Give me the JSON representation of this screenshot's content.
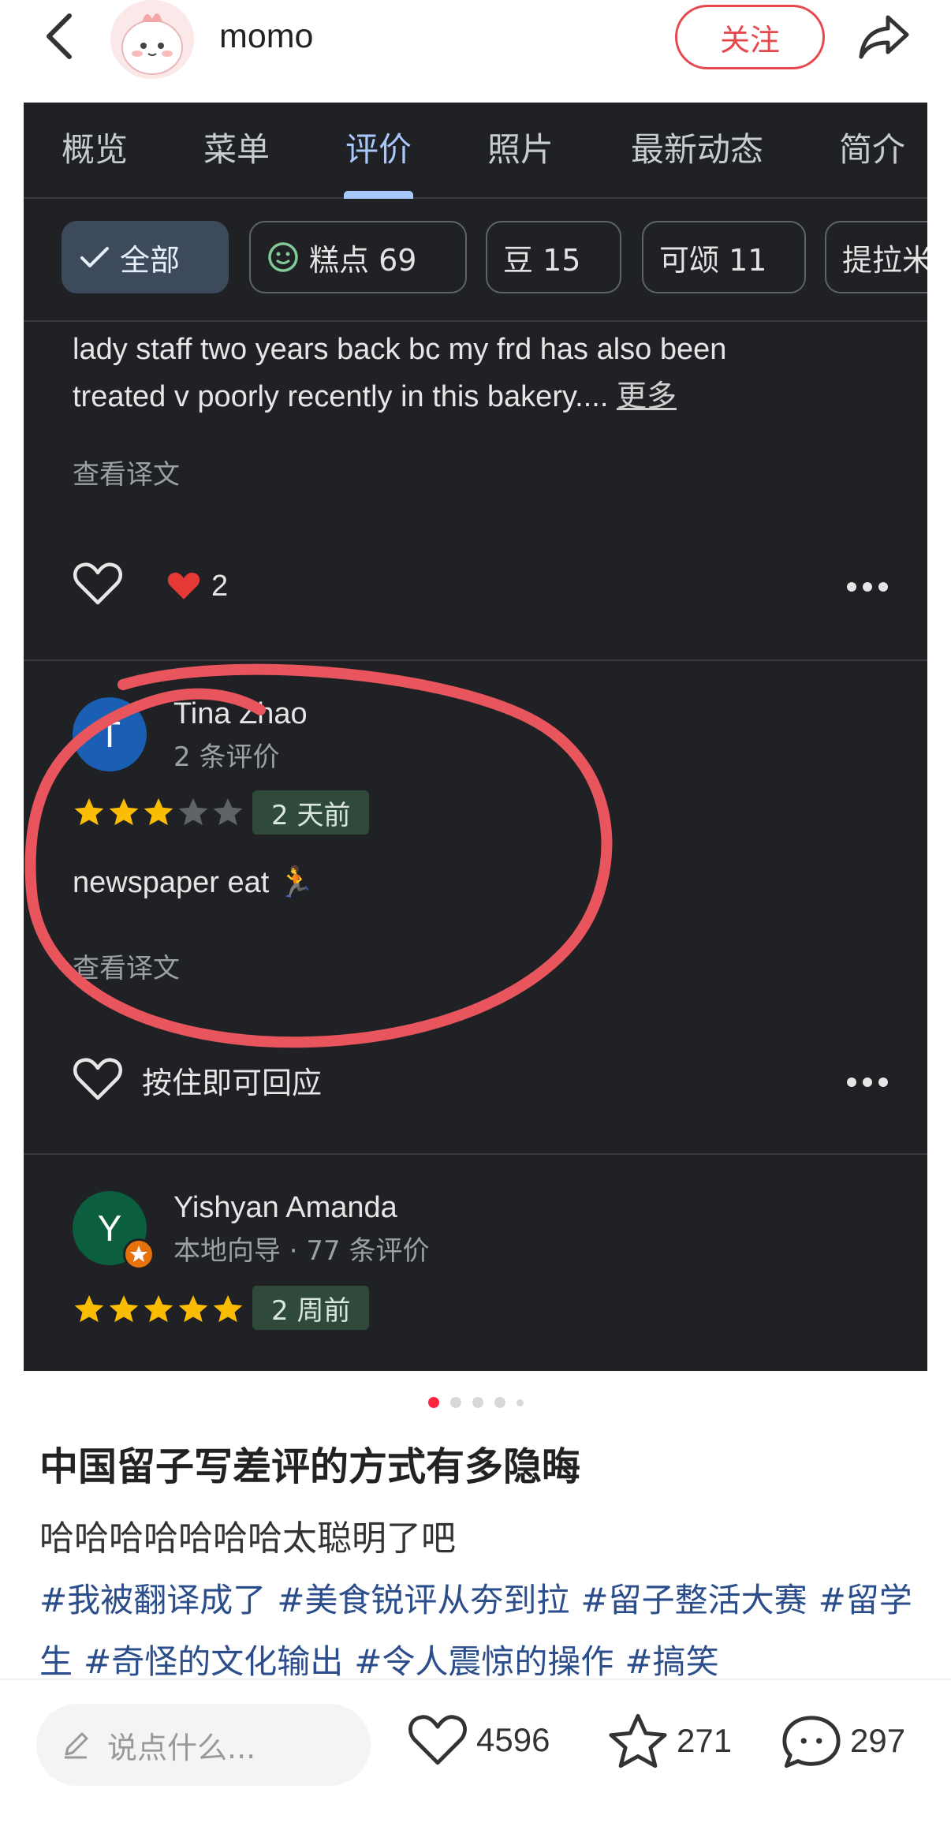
{
  "header": {
    "username": "momo",
    "follow_label": "关注"
  },
  "maps_screenshot": {
    "tabs": [
      "概览",
      "菜单",
      "评价",
      "照片",
      "最新动态",
      "简介"
    ],
    "active_tab": "评价",
    "chips": [
      {
        "label": "全部",
        "selected": true
      },
      {
        "label": "糕点 69",
        "selected": false
      },
      {
        "label": "豆 15",
        "selected": false
      },
      {
        "label": "可颂 11",
        "selected": false
      },
      {
        "label": "提拉米",
        "selected": false
      }
    ],
    "review1": {
      "line1": "lady staff two years back bc my frd has also been",
      "line2": "treated v poorly recently in this bakery....",
      "more": "更多",
      "translate": "查看译文",
      "reaction_count": "2"
    },
    "review2": {
      "avatar_letter": "T",
      "name": "Tina Zhao",
      "meta": "2 条评价",
      "rating": 3,
      "time": "2 天前",
      "text": "newspaper eat 🏃",
      "translate": "查看译文",
      "reply_label": "按住即可回应"
    },
    "review3": {
      "avatar_letter": "Y",
      "name": "Yishyan Amanda",
      "meta": "本地向导 · 77 条评价",
      "rating": 5,
      "time": "2 周前"
    },
    "colors": {
      "panel_bg": "#1f2124",
      "accent_blue": "#a8c7fa",
      "star_gold": "#fbbc04",
      "annotation_red": "#e8555d"
    }
  },
  "post": {
    "title": "中国留子写差评的方式有多隐晦",
    "body": "哈哈哈哈哈哈哈太聪明了吧",
    "hashtags": [
      "#我被翻译成了",
      "#美食锐评从夯到拉",
      "#留子整活大赛",
      "#留学生",
      "#奇怪的文化输出",
      "#令人震惊的操作",
      "#搞笑"
    ]
  },
  "bottom_bar": {
    "comment_placeholder": "说点什么...",
    "likes": "4596",
    "stars": "271",
    "comments": "297"
  }
}
